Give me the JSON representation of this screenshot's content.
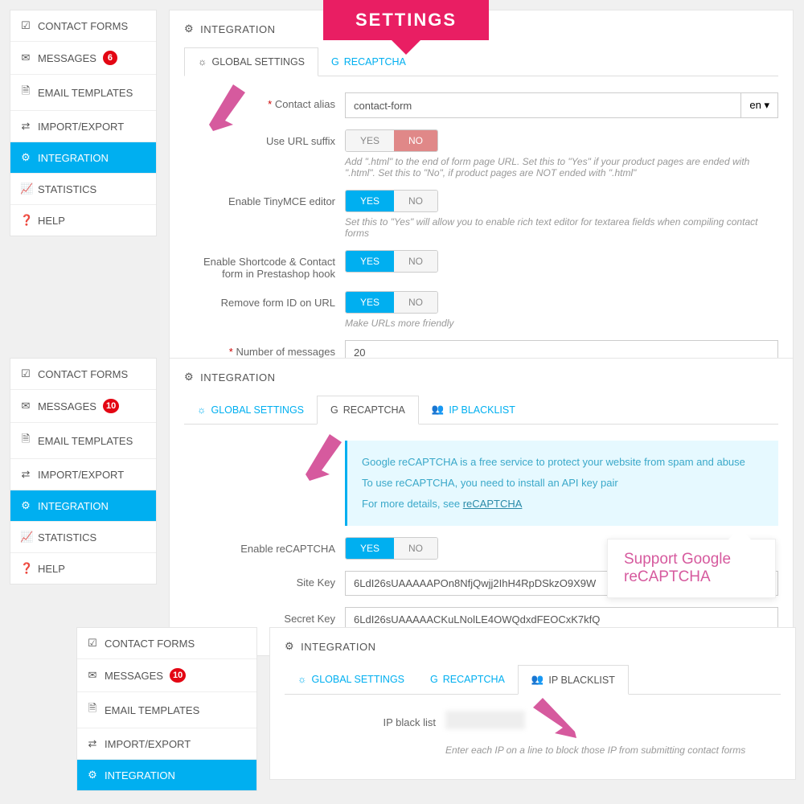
{
  "banner": "SETTINGS",
  "callout": {
    "text1": "Support Google",
    "text2": "reCAPTCHA"
  },
  "sidebar1": {
    "items": [
      {
        "icon": "☑",
        "label": "CONTACT FORMS"
      },
      {
        "icon": "✉",
        "label": "MESSAGES",
        "badge": "6"
      },
      {
        "icon": "🗎",
        "label": "EMAIL TEMPLATES"
      },
      {
        "icon": "⇄",
        "label": "IMPORT/EXPORT"
      },
      {
        "icon": "⚙",
        "label": "INTEGRATION",
        "active": true
      },
      {
        "icon": "📈",
        "label": "STATISTICS"
      },
      {
        "icon": "❓",
        "label": "HELP"
      }
    ]
  },
  "sidebar2_badge": "10",
  "sidebar3_badge": "10",
  "content_header": "INTEGRATION",
  "tabs": {
    "global": "GLOBAL SETTINGS",
    "recaptcha": "RECAPTCHA",
    "ipblacklist": "IP BLACKLIST"
  },
  "form1": {
    "alias_label": "Contact alias",
    "alias_value": "contact-form",
    "lang": "en",
    "url_suffix_label": "Use URL suffix",
    "url_suffix_help": "Add \".html\" to the end of form page URL. Set this to \"Yes\" if your product pages are ended with \".html\". Set this to \"No\", if product pages are NOT ended with \".html\"",
    "tinymce_label": "Enable TinyMCE editor",
    "tinymce_help": "Set this to \"Yes\" will allow you to enable rich text editor for textarea fields when compiling contact forms",
    "shortcode_label": "Enable Shortcode & Contact form in Prestashop hook",
    "remove_id_label": "Remove form ID on URL",
    "remove_id_help": "Make URLs more friendly",
    "msg_count_label": "Number of messages displayed per message page in back office",
    "msg_count_value": "20",
    "yes": "YES",
    "no": "NO"
  },
  "form2": {
    "info1": "Google reCAPTCHA is a free service to protect your website from spam and abuse",
    "info2": "To use reCAPTCHA, you need to install an API key pair",
    "info3a": "For more details, see ",
    "info3b": "reCAPTCHA",
    "enable_label": "Enable reCAPTCHA",
    "sitekey_label": "Site Key",
    "sitekey_value": "6LdI26sUAAAAAPOn8NfjQwjj2IhH4RpDSkzO9X9W",
    "secret_label": "Secret Key",
    "secret_value": "6LdI26sUAAAAACKuLNolLE4OWQdxdFEOCxK7kfQ"
  },
  "form3": {
    "iplist_label": "IP black list",
    "help": "Enter each IP on a line to block those IP from submitting contact forms"
  }
}
